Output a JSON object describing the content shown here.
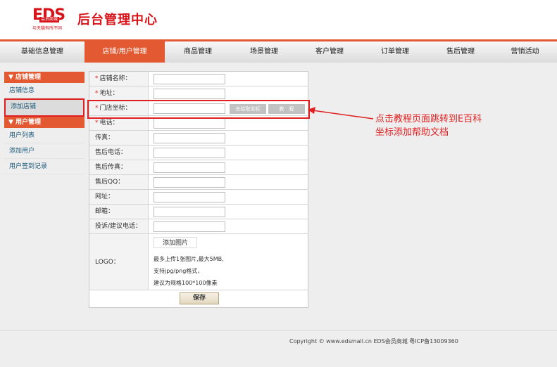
{
  "header": {
    "logo_text": "EDS",
    "logo_sub": "会员商城",
    "logo_slogan": "与天猫有所不同",
    "title": "后台管理中心"
  },
  "nav": [
    "基础信息管理",
    "店铺/用户管理",
    "商品管理",
    "场景管理",
    "客户管理",
    "订单管理",
    "售后管理",
    "营销活动"
  ],
  "sidebar": {
    "shop_header": "▼ 店铺管理",
    "shop_items": [
      "店铺信息",
      "添加店铺"
    ],
    "user_header": "▼ 用户管理",
    "user_items": [
      "用户列表",
      "添加用户",
      "用户签到记录"
    ]
  },
  "form": {
    "shop_name": "店铺名称：",
    "address": "地址：",
    "coords": "门店坐标：",
    "get_coords_btn": "去拾取坐标",
    "tutorial_btn": "教　程",
    "phone": "电话：",
    "fax": "传真：",
    "aftersale_phone": "售后电话：",
    "aftersale_fax": "售后传真：",
    "aftersale_qq": "售后QQ：",
    "website": "网址：",
    "email": "邮箱：",
    "complaint_phone": "投诉/建议电话：",
    "logo_label": "LOGO：",
    "upload_btn": "添加图片",
    "hint1": "最多上传1张图片,最大5MB,",
    "hint2": "支持jpg/png格式，",
    "hint3": "建议为规格100*100像素",
    "save_btn": "保存"
  },
  "annotation": {
    "line1": "点击教程页面跳转到E百科",
    "line2": "坐标添加帮助文档"
  },
  "footer": "Copyright © www.edsmall.cn EDS会员商城 粤ICP备13009360",
  "colors": {
    "accent": "#e35a32",
    "annotation": "#e02020"
  }
}
